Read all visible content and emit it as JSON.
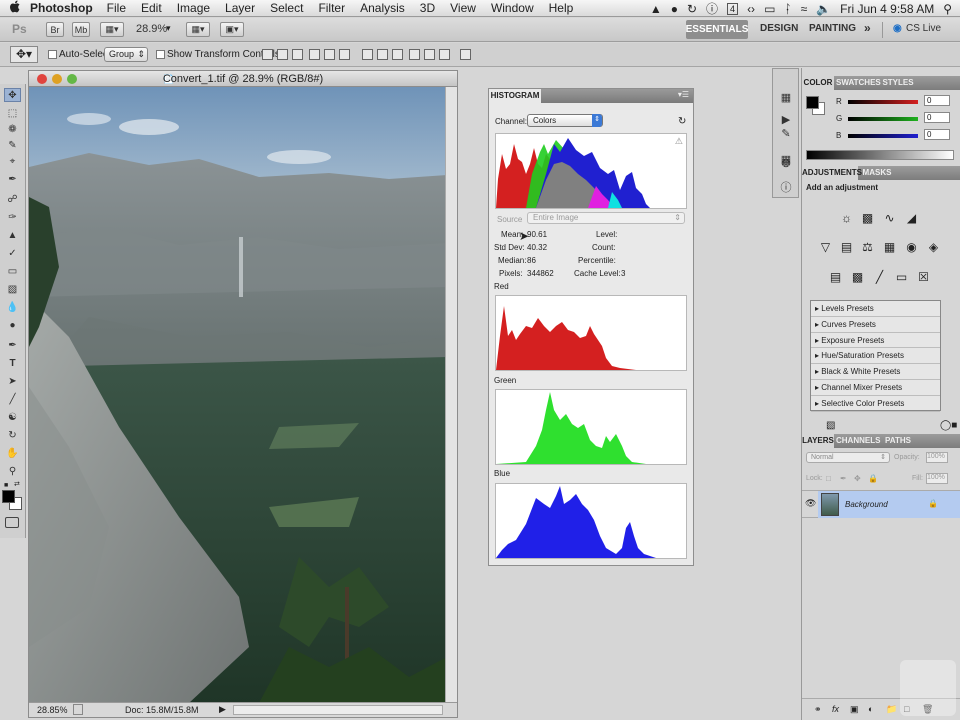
{
  "menubar": {
    "apple": "",
    "app": "Photoshop",
    "items": [
      "File",
      "Edit",
      "Image",
      "Layer",
      "Select",
      "Filter",
      "Analysis",
      "3D",
      "View",
      "Window",
      "Help"
    ],
    "clock": "Fri Jun 4  9:58 AM",
    "battery_badge": "4"
  },
  "appbar": {
    "ps": "Ps",
    "br": "Br",
    "mb": "Mb",
    "zoom": "28.9%",
    "workspaces": [
      "ESSENTIALS",
      "DESIGN",
      "PAINTING"
    ],
    "more": "»",
    "cslive": "CS Live"
  },
  "options": {
    "auto_select": "Auto-Select:",
    "group": "Group",
    "transform": "Show Transform Controls"
  },
  "document": {
    "title": "Convert_1.tif @ 28.9% (RGB/8#)",
    "zoom": "28.85%",
    "doc_info": "Doc: 15.8M/15.8M"
  },
  "histogram": {
    "tab": "HISTOGRAM",
    "channel_label": "Channel:",
    "channel_value": "Colors",
    "source_label": "Source",
    "source_value": "Entire Image",
    "stats": {
      "mean_label": "Mean:",
      "mean": "90.61",
      "std_label": "Std Dev:",
      "std": "40.32",
      "median_label": "Median:",
      "median": "86",
      "pixels_label": "Pixels:",
      "pixels": "344862",
      "level_label": "Level:",
      "count_label": "Count:",
      "percentile_label": "Percentile:",
      "cache_label": "Cache Level:",
      "cache": "3"
    },
    "red_label": "Red",
    "green_label": "Green",
    "blue_label": "Blue"
  },
  "color_panel": {
    "tabs": [
      "COLOR",
      "SWATCHES",
      "STYLES"
    ],
    "r_label": "R",
    "g_label": "G",
    "b_label": "B",
    "r": "0",
    "g": "0",
    "b": "0",
    "colors": {
      "red": "#d42020",
      "green": "#1fb21f",
      "blue": "#2020d0"
    }
  },
  "adjustments": {
    "tabs": [
      "ADJUSTMENTS",
      "MASKS"
    ],
    "heading": "Add an adjustment",
    "presets": [
      "Levels Presets",
      "Curves Presets",
      "Exposure Presets",
      "Hue/Saturation Presets",
      "Black & White Presets",
      "Channel Mixer Presets",
      "Selective Color Presets"
    ]
  },
  "layers": {
    "tabs": [
      "LAYERS",
      "CHANNELS",
      "PATHS"
    ],
    "blend": "Normal",
    "opacity_label": "Opacity:",
    "opacity": "100%",
    "lock_label": "Lock:",
    "fill_label": "Fill:",
    "fill": "100%",
    "layer_name": "Background"
  }
}
